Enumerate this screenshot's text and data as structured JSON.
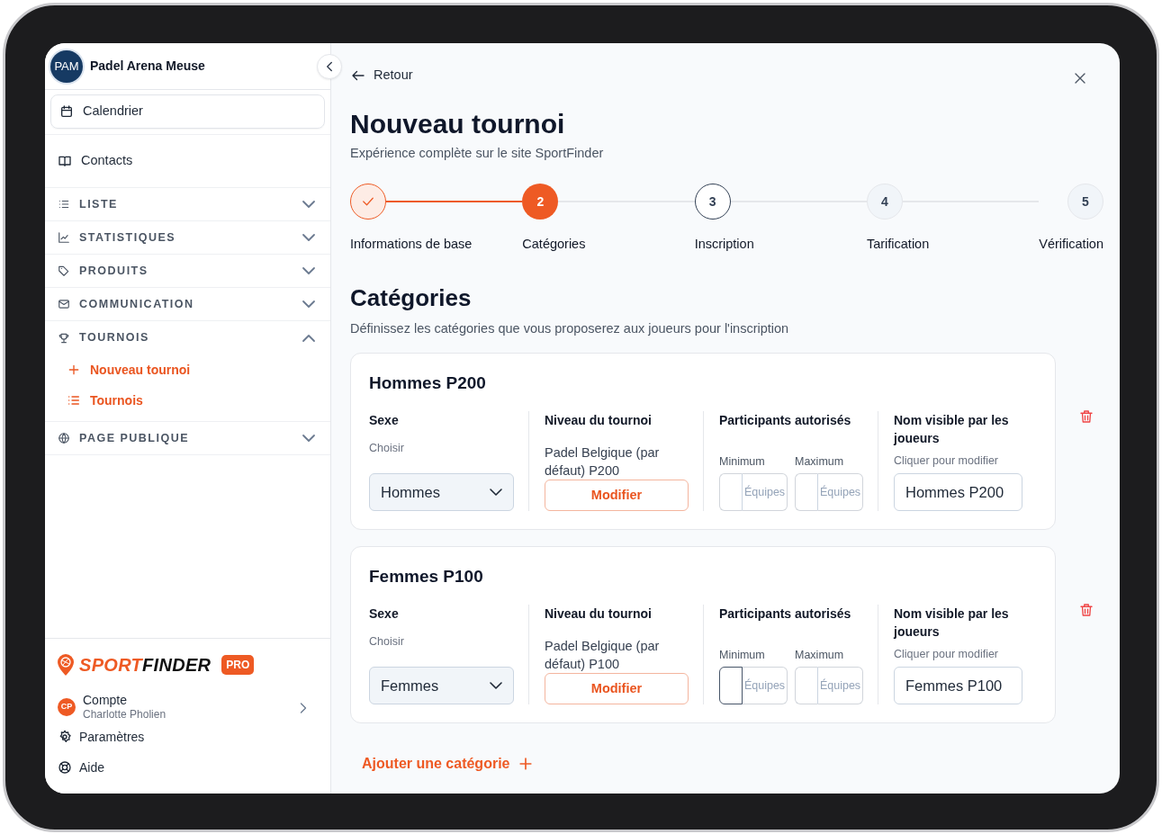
{
  "sidebar": {
    "venue": {
      "initials": "PAM",
      "name": "Padel Arena Meuse"
    },
    "items": [
      {
        "kind": "link",
        "label": "Calendrier",
        "selected": true
      },
      {
        "kind": "link",
        "label": "Contacts",
        "selected": false
      },
      {
        "kind": "section",
        "label": "LISTE",
        "expanded": false
      },
      {
        "kind": "section",
        "label": "STATISTIQUES",
        "expanded": false
      },
      {
        "kind": "section",
        "label": "PRODUITS",
        "expanded": false
      },
      {
        "kind": "section",
        "label": "COMMUNICATION",
        "expanded": false
      },
      {
        "kind": "section",
        "label": "TOURNOIS",
        "expanded": true,
        "children": [
          {
            "label": "Nouveau tournoi"
          },
          {
            "label": "Tournois"
          }
        ]
      },
      {
        "kind": "section",
        "label": "PAGE PUBLIQUE",
        "expanded": false
      }
    ],
    "brand": {
      "first": "SPORT",
      "second": "FINDER",
      "badge": "PRO"
    },
    "account": {
      "initials": "CP",
      "label": "Compte",
      "user": "Charlotte Pholien"
    },
    "links": [
      "Paramètres",
      "Aide"
    ]
  },
  "main": {
    "back": "Retour",
    "title": "Nouveau tournoi",
    "subtitle": "Expérience complète sur le site SportFinder",
    "steps": [
      {
        "label": "Informations de base",
        "done": true,
        "selected": false
      },
      {
        "number": "2",
        "label": "Catégories",
        "done": false,
        "selected": true
      },
      {
        "number": "3",
        "label": "Inscription",
        "done": false,
        "selected": false,
        "available": true
      },
      {
        "number": "4",
        "label": "Tarification",
        "done": false,
        "selected": false,
        "available": false
      },
      {
        "number": "5",
        "label": "Vérification",
        "done": false,
        "selected": false,
        "available": false
      }
    ],
    "section": {
      "title": "Catégories",
      "description": "Définissez les catégories que vous proposerez aux joueurs pour l'inscription"
    },
    "categories": [
      {
        "title": "Hommes P200",
        "sex_label": "Sexe",
        "sex_hint": "Choisir",
        "sex_value": "Hommes",
        "level_label": "Niveau du tournoi",
        "level_value": "Padel Belgique (par défaut) P200",
        "level_button": "Modifier",
        "participants_label": "Participants autorisés",
        "min_label": "Minimum",
        "max_label": "Maximum",
        "min_unit": "Équipes",
        "max_unit": "Équipes",
        "min_focused": false,
        "name_label": "Nom visible par les joueurs",
        "name_hint": "Cliquer pour modifier",
        "name_value": "Hommes P200"
      },
      {
        "title": "Femmes P100",
        "sex_label": "Sexe",
        "sex_hint": "Choisir",
        "sex_value": "Femmes",
        "level_label": "Niveau du tournoi",
        "level_value": "Padel Belgique (par défaut) P100",
        "level_button": "Modifier",
        "participants_label": "Participants autorisés",
        "min_label": "Minimum",
        "max_label": "Maximum",
        "min_unit": "Équipes",
        "max_unit": "Équipes",
        "min_focused": true,
        "name_label": "Nom visible par les joueurs",
        "name_hint": "Cliquer pour modifier",
        "name_value": "Femmes P100"
      }
    ],
    "add_button": "Ajouter une catégorie"
  }
}
